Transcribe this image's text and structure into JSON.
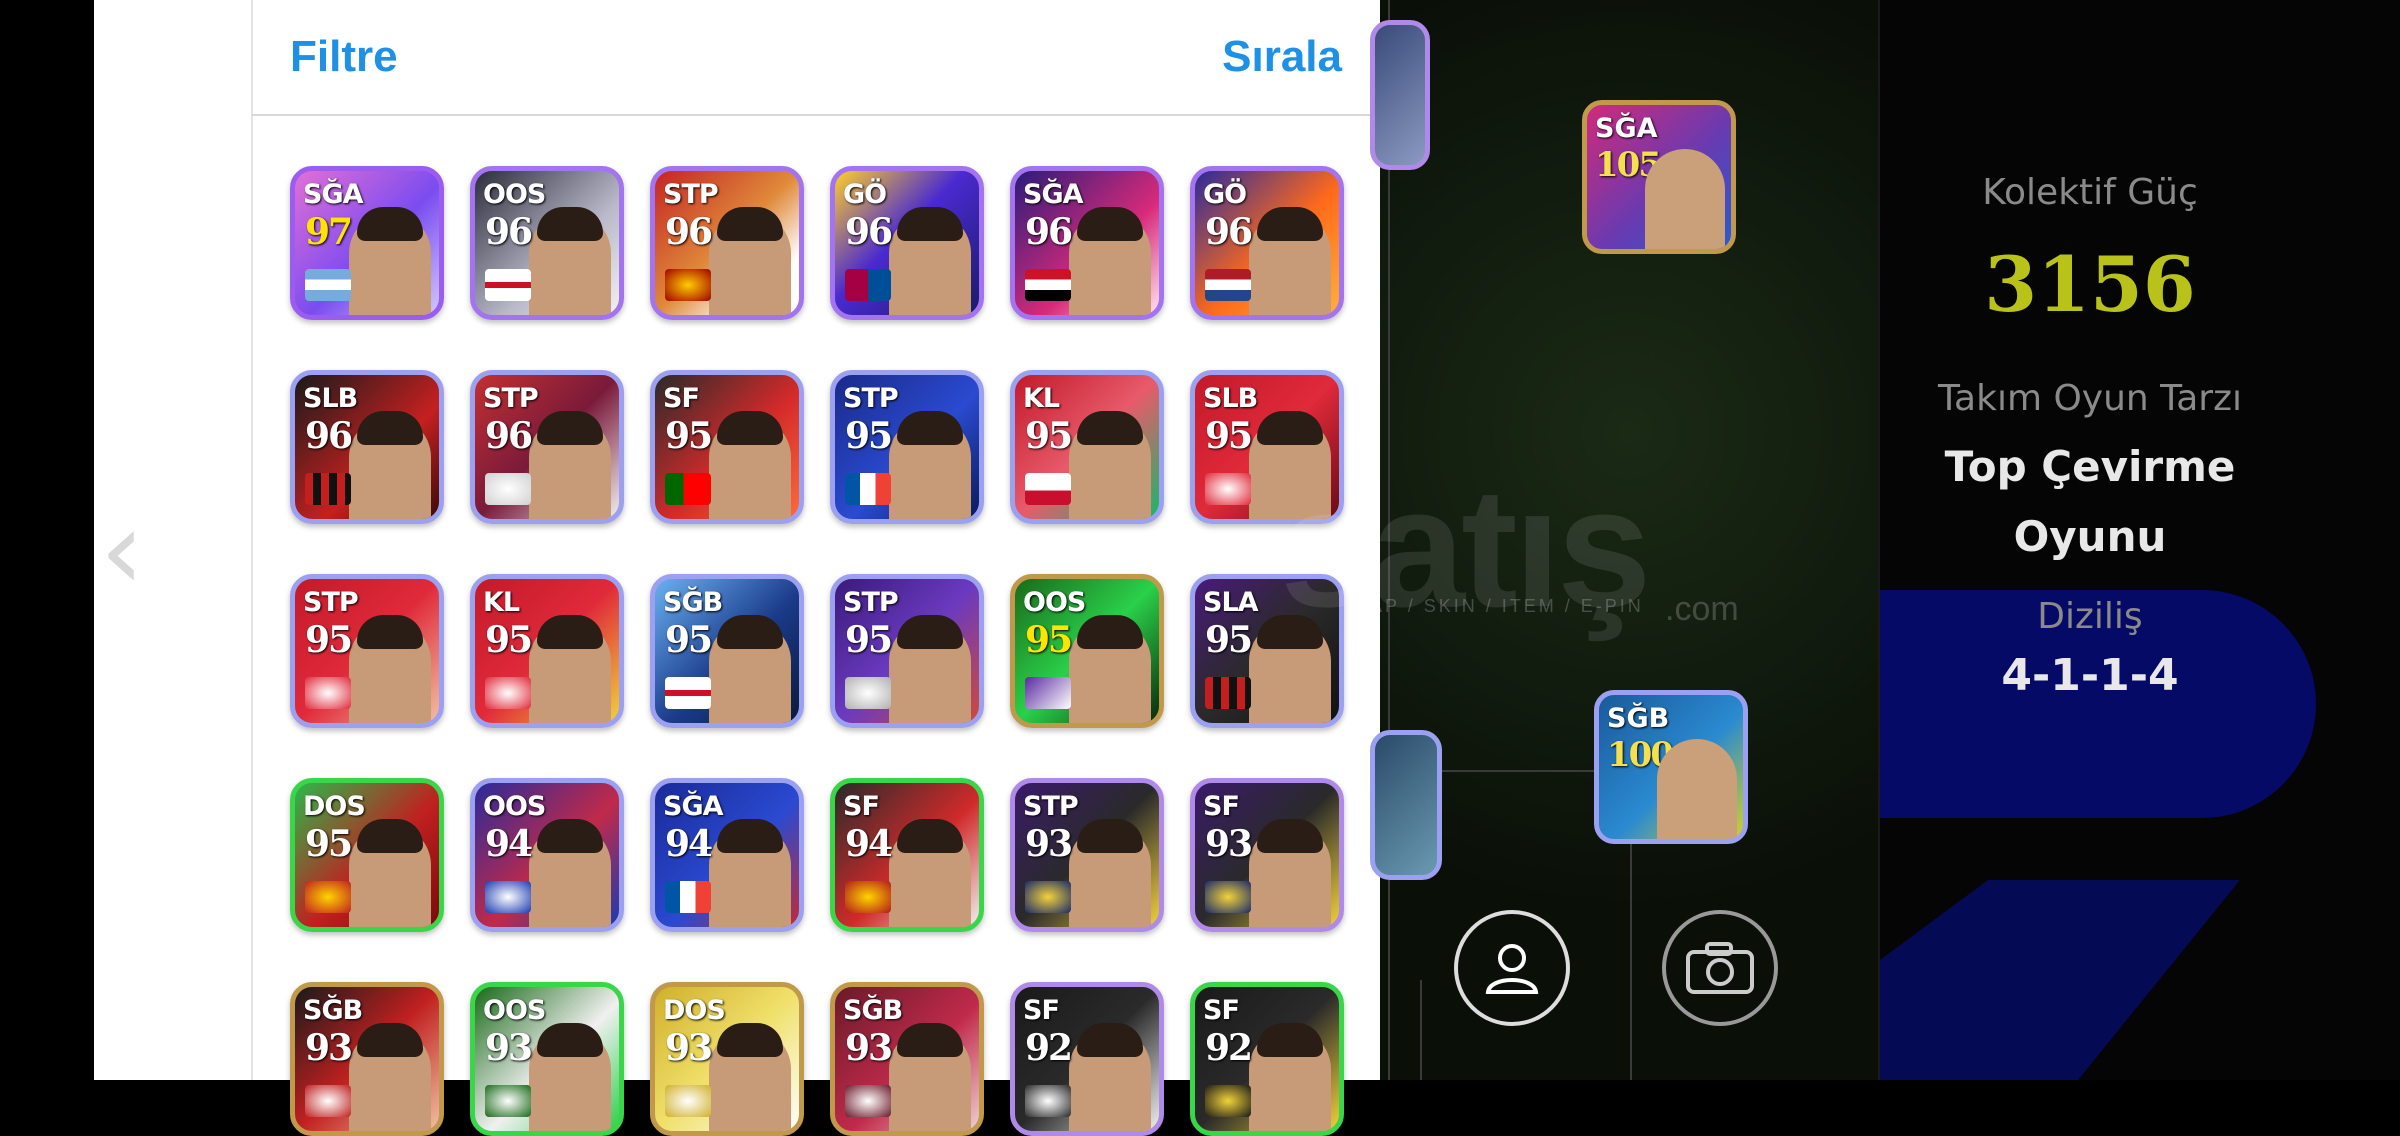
{
  "header": {
    "filter_label": "Filtre",
    "sort_label": "Sırala"
  },
  "colors": {
    "accent": "#1e90e6",
    "power": "#b8c218",
    "panel_blue": "#050a66"
  },
  "cards": [
    {
      "pos": "SĞA",
      "rating": "97",
      "frame": "#9b5cf0",
      "bg": "linear-gradient(135deg,#e26fd6,#7b4cf0 55%,#cfc8ff)",
      "badge": "linear-gradient(#74acdf 33%,#fff 33%,#fff 66%,#74acdf 66%)",
      "rating_color": "#ffe400"
    },
    {
      "pos": "OOS",
      "rating": "96",
      "frame": "#a373f0",
      "bg": "linear-gradient(135deg,#2b2c3c,#b8b8c8 60%,#f2f2f2)",
      "badge": "linear-gradient(#fff 40%,#ce1124 40%,#ce1124 60%,#fff 60%)"
    },
    {
      "pos": "STP",
      "rating": "96",
      "frame": "#a373f0",
      "bg": "linear-gradient(135deg,#c42424,#e08a3a 50%,#ffffff 80%)",
      "badge": "radial-gradient(#ffcc00,#a00000)"
    },
    {
      "pos": "GÖ",
      "rating": "96",
      "frame": "#a373f0",
      "bg": "linear-gradient(135deg,#ffcf2a,#4a2ad0 45%,#1a1a6a)",
      "badge": "linear-gradient(90deg,#a50044 50%,#004d98 50%)"
    },
    {
      "pos": "SĞA",
      "rating": "96",
      "frame": "#a373f0",
      "bg": "linear-gradient(135deg,#2a1c7a,#d82a7a 60%,#ffe4f0)",
      "badge": "linear-gradient(#ce1126 33%,#fff 33%,#fff 66%,#000 66%)"
    },
    {
      "pos": "GÖ",
      "rating": "96",
      "frame": "#a373f0",
      "bg": "linear-gradient(135deg,#2a2a9a,#ff6a1a 55%,#ffb03a)",
      "badge": "linear-gradient(#ae1c28 33%,#fff 33%,#fff 66%,#21468b 66%)"
    },
    {
      "pos": "SLB",
      "rating": "96",
      "frame": "#9ca0f0",
      "bg": "linear-gradient(135deg,#1a1a1a,#c42020 60%,#3a0a0a)",
      "badge": "repeating-linear-gradient(90deg,#c41e1e 0 8px,#111 8px 16px)"
    },
    {
      "pos": "STP",
      "rating": "96",
      "frame": "#9ca0f0",
      "bg": "linear-gradient(135deg,#c23030,#7a1a3a 50%,#f0f0f0)",
      "badge": "radial-gradient(#fff,#d0d0d0)"
    },
    {
      "pos": "SF",
      "rating": "95",
      "frame": "#9ca0f0",
      "bg": "linear-gradient(135deg,#2a2a2a,#d42a2a 55%,#ff6a3a)",
      "badge": "linear-gradient(90deg,#006600 40%,#ff0000 40%)"
    },
    {
      "pos": "STP",
      "rating": "95",
      "frame": "#9ca0f0",
      "bg": "linear-gradient(135deg,#1a2a8a,#2a4ad0 55%,#0a1a5a)",
      "badge": "linear-gradient(90deg,#0055a4 33%,#fff 33%,#fff 66%,#ef4135 66%)"
    },
    {
      "pos": "KL",
      "rating": "95",
      "frame": "#9ca0f0",
      "bg": "linear-gradient(135deg,#c21a2a,#e85a6a 50%,#18b86a)",
      "badge": "linear-gradient(#fff 55%,#c8102e 55%)"
    },
    {
      "pos": "SLB",
      "rating": "95",
      "frame": "#9ca0f0",
      "bg": "linear-gradient(135deg,#c21a2a,#e02a3a 50%,#6a0a14)",
      "badge": "radial-gradient(#fff,#e02a3a)"
    },
    {
      "pos": "STP",
      "rating": "95",
      "frame": "#9ca0f0",
      "bg": "linear-gradient(135deg,#c21a2a,#e02a3a 50%,#f2c0a0)",
      "badge": "radial-gradient(#fff,#e02a3a)"
    },
    {
      "pos": "KL",
      "rating": "95",
      "frame": "#9ca0f0",
      "bg": "linear-gradient(135deg,#c21a2a,#e02a3a 50%,#f2d23a)",
      "badge": "radial-gradient(#fff,#e02a3a)"
    },
    {
      "pos": "SĞB",
      "rating": "95",
      "frame": "#9ca0f0",
      "bg": "linear-gradient(135deg,#6ab0f0,#1a3a8a 55%,#0a1a3a)",
      "badge": "linear-gradient(#fff 40%,#ce1124 40%,#ce1124 60%,#fff 60%)"
    },
    {
      "pos": "STP",
      "rating": "95",
      "frame": "#9ca0f0",
      "bg": "linear-gradient(135deg,#3a1a7a,#6a3ac0 50%,#d04a3a)",
      "badge": "radial-gradient(#fff,#b0b0b0)"
    },
    {
      "pos": "OOS",
      "rating": "95",
      "frame": "#c09a4a",
      "bg": "linear-gradient(135deg,#1a6a1a,#2ad04a 50%,#0a2a0a)",
      "badge": "linear-gradient(135deg,#5a2aa0,#fff)",
      "rating_color": "#ffe400"
    },
    {
      "pos": "SLA",
      "rating": "95",
      "frame": "#9ca0f0",
      "bg": "linear-gradient(135deg,#4a1a7a,#2a2a2a 50%,#111)",
      "badge": "repeating-linear-gradient(90deg,#c41e1e 0 8px,#111 8px 16px)"
    },
    {
      "pos": "DOS",
      "rating": "95",
      "frame": "#39d64a",
      "bg": "linear-gradient(135deg,#2ab84a,#c02020 55%,#7a0a0a)",
      "badge": "radial-gradient(#ffd400,#c02020)"
    },
    {
      "pos": "OOS",
      "rating": "94",
      "frame": "#9ca0f0",
      "bg": "linear-gradient(135deg,#2a2a9a,#c02a4a 55%,#1a3ab0)",
      "badge": "radial-gradient(#fff,#1a3ab0)"
    },
    {
      "pos": "SĞA",
      "rating": "94",
      "frame": "#9ca0f0",
      "bg": "linear-gradient(135deg,#1a2a9a,#2a4ad0 55%,#c02a3a)",
      "badge": "linear-gradient(90deg,#0055a4 33%,#fff 33%,#fff 66%,#ef4135 66%)"
    },
    {
      "pos": "SF",
      "rating": "94",
      "frame": "#39d64a",
      "bg": "linear-gradient(135deg,#2a2a2a,#d02a2a 55%,#f0f0f0)",
      "badge": "radial-gradient(#ffd400,#b01a1a)"
    },
    {
      "pos": "STP",
      "rating": "93",
      "frame": "#b08ae8",
      "bg": "linear-gradient(135deg,#3a1a6a,#2a2a2a 50%,#f2d23a)",
      "badge": "radial-gradient(#f2d23a,#1a2a6a)"
    },
    {
      "pos": "SF",
      "rating": "93",
      "frame": "#b08ae8",
      "bg": "linear-gradient(135deg,#3a1a6a,#2a2a2a 50%,#f2d23a)",
      "badge": "radial-gradient(#f2d23a,#1a2a6a)"
    },
    {
      "pos": "SĞB",
      "rating": "93",
      "frame": "#c09a4a",
      "bg": "linear-gradient(135deg,#1a1a1a,#c02020 50%,#f2c0a0)",
      "badge": "radial-gradient(#fff,#c02020)"
    },
    {
      "pos": "OOS",
      "rating": "93",
      "frame": "#39d64a",
      "bg": "linear-gradient(135deg,#1a6a1a,#f0f0f0 55%,#2ad04a)",
      "badge": "radial-gradient(#fff,#1a6a1a)"
    },
    {
      "pos": "DOS",
      "rating": "93",
      "frame": "#c09a4a",
      "bg": "linear-gradient(135deg,#d0b02a,#f0e06a 50%,#fff)",
      "badge": "radial-gradient(#fff,#d0b02a)"
    },
    {
      "pos": "SĞB",
      "rating": "93",
      "frame": "#c09a4a",
      "bg": "linear-gradient(135deg,#6a1a2a,#c02a4a 55%,#f0d0d0)",
      "badge": "radial-gradient(#fff,#6a1a2a)"
    },
    {
      "pos": "SF",
      "rating": "92",
      "frame": "#b08ae8",
      "bg": "linear-gradient(135deg,#1a1a1a,#2a2a2a 50%,#f0f0f0)",
      "badge": "radial-gradient(#fff,#2a2a2a)"
    },
    {
      "pos": "SF",
      "rating": "92",
      "frame": "#39d64a",
      "bg": "linear-gradient(135deg,#1a1a1a,#2a2a2a 50%,#f2d23a)",
      "badge": "radial-gradient(#f2d23a,#1a1a1a)"
    }
  ],
  "field_cards": [
    {
      "pos": "SĞA",
      "rating": "105"
    },
    {
      "pos": "SĞB",
      "rating": "100"
    }
  ],
  "watermark": {
    "main": "satış",
    "sub": "AP / SKIN / ITEM / E-PIN",
    "com": ".com"
  },
  "team_panel": {
    "power_label": "Kolektif Güç",
    "power_value": "3156",
    "style_label": "Takım Oyun Tarzı",
    "style_value_line1": "Top Çevirme",
    "style_value_line2": "Oyunu",
    "formation_label": "Diziliş",
    "formation_value": "4-1-1-4"
  },
  "icons": [
    "chevron-left-icon",
    "player-profile-icon",
    "camera-icon"
  ]
}
